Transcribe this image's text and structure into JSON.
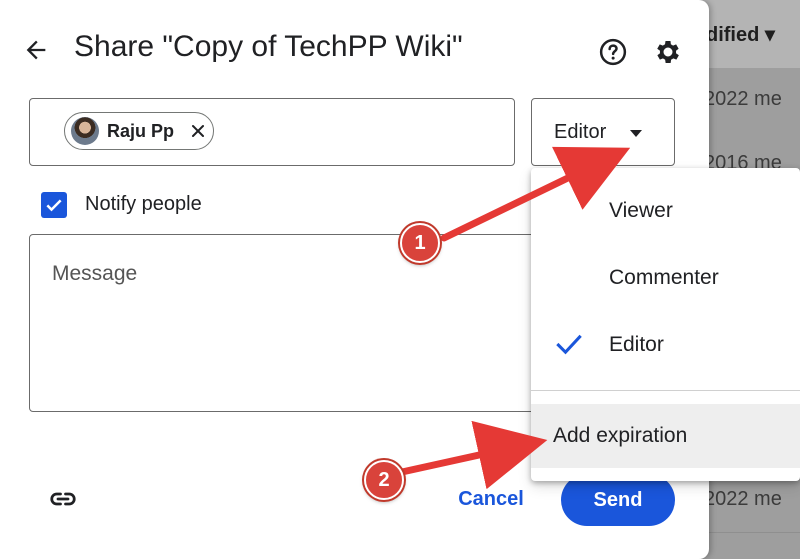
{
  "background": {
    "sort_label": "dified",
    "rows": [
      "2022 me",
      "2016 me",
      "",
      "",
      "",
      "",
      "",
      "2022 me"
    ]
  },
  "dialog": {
    "title": "Share \"Copy of TechPP Wiki\"",
    "chip_name": "Raju Pp",
    "role_selected": "Editor",
    "notify_label": "Notify people",
    "notify_checked": true,
    "message_placeholder": "Message",
    "cancel_label": "Cancel",
    "send_label": "Send"
  },
  "menu": {
    "items": [
      {
        "label": "Viewer",
        "checked": false
      },
      {
        "label": "Commenter",
        "checked": false
      },
      {
        "label": "Editor",
        "checked": true
      }
    ],
    "expire_label": "Add expiration"
  },
  "annotations": {
    "marker_1": "1",
    "marker_2": "2"
  },
  "colors": {
    "accent": "#1a56db",
    "annotation": "#e53935"
  }
}
